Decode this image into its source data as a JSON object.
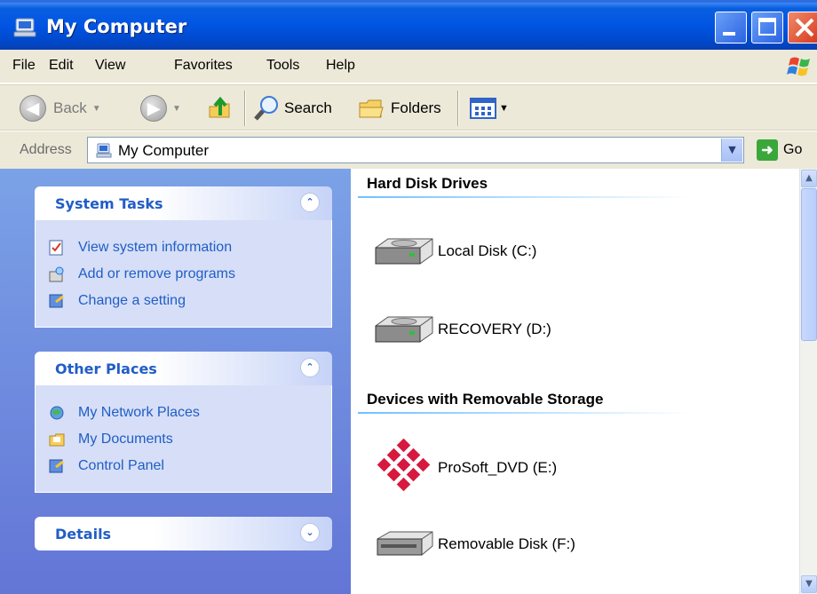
{
  "window": {
    "title": "My Computer",
    "icon": "my-computer-icon"
  },
  "menu": [
    "File",
    "Edit",
    "View",
    "Favorites",
    "Tools",
    "Help"
  ],
  "toolbar": {
    "back_label": "Back",
    "search_label": "Search",
    "folders_label": "Folders"
  },
  "address": {
    "label": "Address",
    "value": "My Computer",
    "go_label": "Go"
  },
  "task_pane": {
    "system_tasks": {
      "title": "System Tasks",
      "items": [
        "View system information",
        "Add or remove programs",
        "Change a setting"
      ]
    },
    "other_places": {
      "title": "Other Places",
      "items": [
        "My Network Places",
        "My Documents",
        "Control Panel"
      ]
    },
    "details": {
      "title": "Details"
    }
  },
  "content": {
    "hard_disk_group": "Hard Disk Drives",
    "hard_disks": [
      "Local Disk (C:)",
      "RECOVERY (D:)"
    ],
    "removable_group": "Devices with Removable Storage",
    "removable": [
      "ProSoft_DVD (E:)",
      "Removable Disk (F:)"
    ]
  },
  "colors": {
    "title_blue": "#0054e3",
    "task_link": "#215dc6",
    "task_pane_bg": "#7ba2e7",
    "close_red": "#d6341a"
  }
}
